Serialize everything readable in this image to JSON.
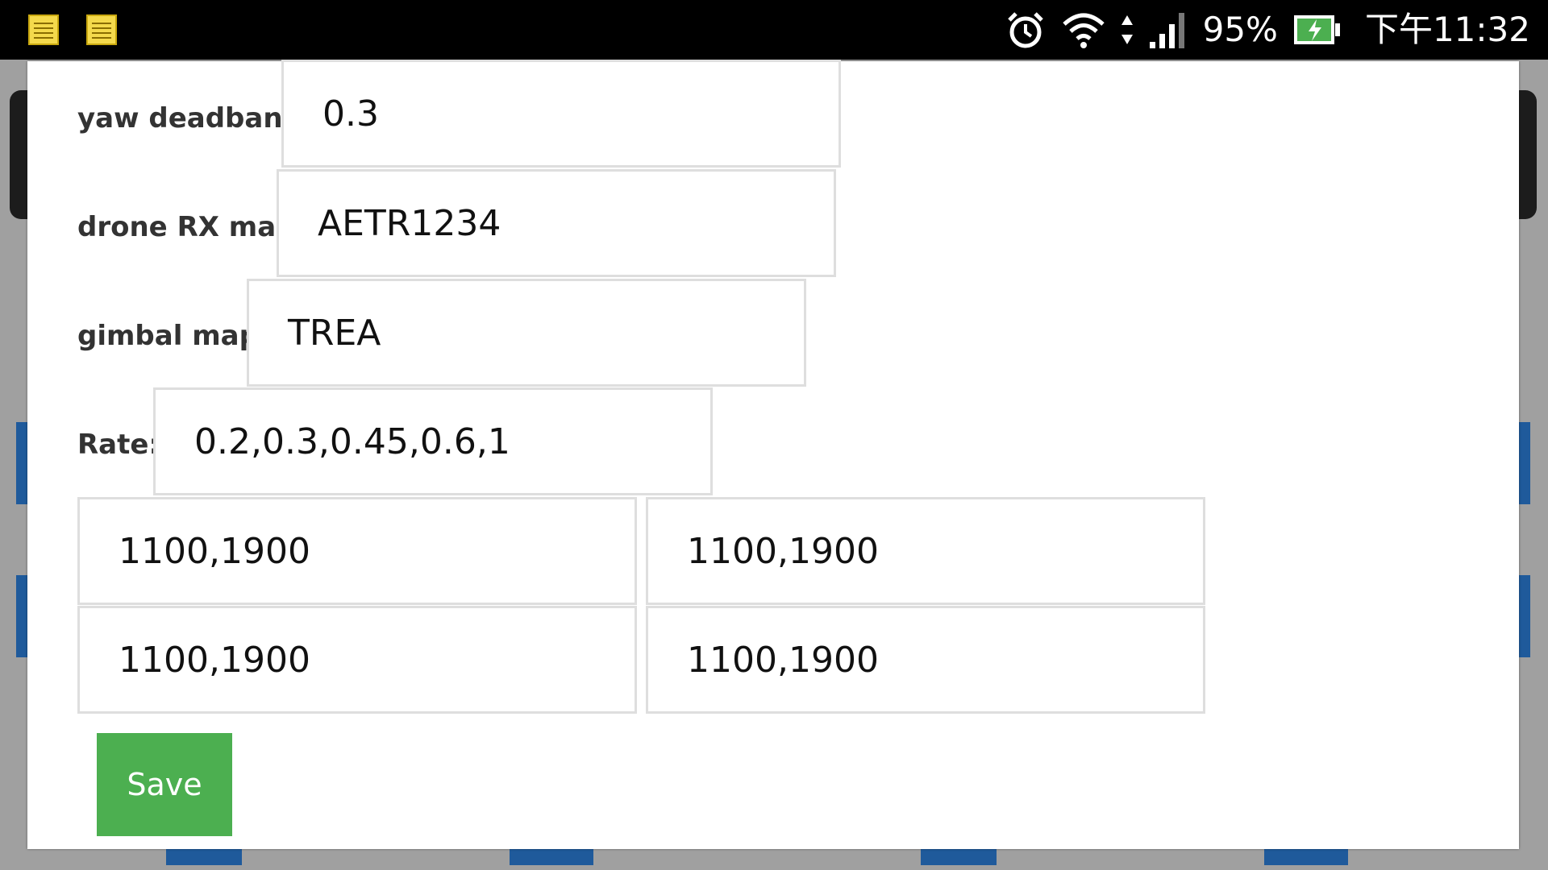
{
  "status_bar": {
    "battery_percent": "95%",
    "clock": "下午11:32",
    "icons": [
      "notes-icon",
      "notes-icon",
      "alarm-icon",
      "wifi-icon",
      "data-arrows-icon",
      "signal-icon",
      "battery-charging-icon"
    ]
  },
  "form": {
    "yaw_deadband": {
      "label": "yaw deadband:",
      "value": "0.3"
    },
    "drone_rx_map": {
      "label": "drone RX map:",
      "value": "AETR1234"
    },
    "gimbal_map": {
      "label": "gimbal map:",
      "value": "TREA"
    },
    "rate": {
      "label": "Rate:",
      "value": "0.2,0.3,0.45,0.6,1"
    },
    "ranges": [
      "1100,1900",
      "1100,1900",
      "1100,1900",
      "1100,1900"
    ],
    "save_label": "Save"
  },
  "colors": {
    "save_button": "#4caf50",
    "field_border": "#dedede",
    "background_overlay": "#a0a0a0",
    "background_accent": "#1f5a9b"
  }
}
